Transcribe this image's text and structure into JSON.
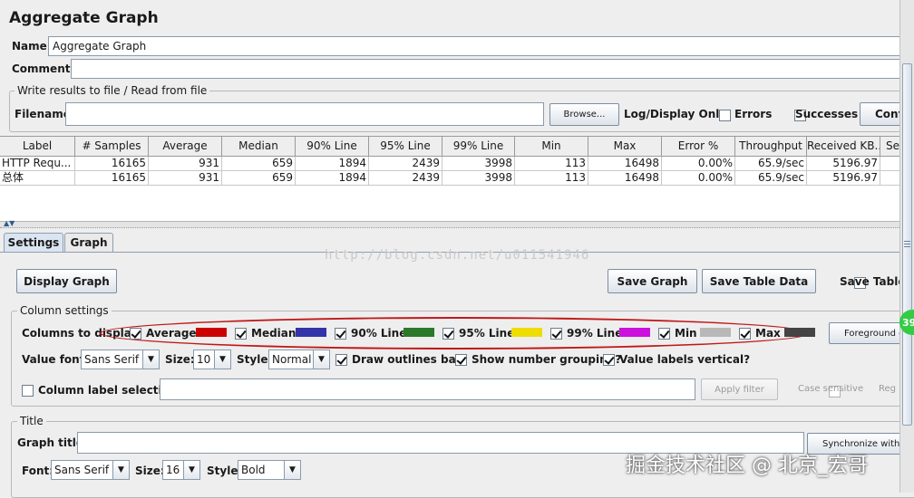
{
  "panel": {
    "title": "Aggregate Graph"
  },
  "name": {
    "label": "Name:",
    "value": "Aggregate Graph"
  },
  "comments": {
    "label": "Comments:",
    "value": ""
  },
  "file": {
    "legend": "Write results to file / Read from file",
    "filename_label": "Filename",
    "filename_value": "",
    "browse": "Browse...",
    "log_display": "Log/Display Only:",
    "errors": "Errors",
    "successes": "Successes",
    "configure": "Conf"
  },
  "table": {
    "columns": [
      "Label",
      "# Samples",
      "Average",
      "Median",
      "90% Line",
      "95% Line",
      "99% Line",
      "Min",
      "Max",
      "Error %",
      "Throughput",
      "Received KB...",
      "Se"
    ],
    "rows": [
      [
        "HTTP Requ...",
        "16165",
        "931",
        "659",
        "1894",
        "2439",
        "3998",
        "113",
        "16498",
        "0.00%",
        "65.9/sec",
        "5196.97",
        ""
      ],
      [
        "总体",
        "16165",
        "931",
        "659",
        "1894",
        "2439",
        "3998",
        "113",
        "16498",
        "0.00%",
        "65.9/sec",
        "5196.97",
        ""
      ]
    ]
  },
  "tabs": [
    "Settings",
    "Graph"
  ],
  "buttons": {
    "display_graph": "Display Graph",
    "save_graph": "Save Graph",
    "save_table_data": "Save Table Data",
    "save_table_header": "Save Table"
  },
  "column_settings": {
    "legend": "Column settings",
    "columns_label": "Columns to display:",
    "columns": [
      {
        "name": "Average",
        "checked": true,
        "color": "#cc0000"
      },
      {
        "name": "Median",
        "checked": true,
        "color": "#3333aa"
      },
      {
        "name": "90% Line",
        "checked": true,
        "color": "#2a7a2a"
      },
      {
        "name": "95% Line",
        "checked": true,
        "color": "#eedd00"
      },
      {
        "name": "99% Line",
        "checked": true,
        "color": "#cc11dd"
      },
      {
        "name": "Min",
        "checked": true,
        "color": "#b8b8b8"
      },
      {
        "name": "Max",
        "checked": true,
        "color": "#444444"
      }
    ],
    "foreground": "Foreground c",
    "value_font_label": "Value font:",
    "value_font": "Sans Serif",
    "size_label": "Size:",
    "size": "10",
    "style_label": "Style:",
    "style": "Normal",
    "draw_outlines": "Draw outlines bar?",
    "number_grouping": "Show number grouping?",
    "labels_vertical": "Value labels vertical?",
    "column_label_selection": "Column label selection:",
    "apply_filter": "Apply filter",
    "case_sensitive": "Case sensitive",
    "regexp": "Reg"
  },
  "title_section": {
    "legend": "Title",
    "graph_title_label": "Graph title:",
    "graph_title_value": "",
    "synchronize": "Synchronize with",
    "font_label": "Font:",
    "font": "Sans Serif",
    "size_label": "Size:",
    "size": "16",
    "style_label": "Style:",
    "style": "Bold"
  },
  "overlays": {
    "watermark_url": "http://blog.csdn.net/u011541946",
    "watermark_cn": "掘金技术社区 @ 北京_宏哥",
    "badge": "39"
  }
}
